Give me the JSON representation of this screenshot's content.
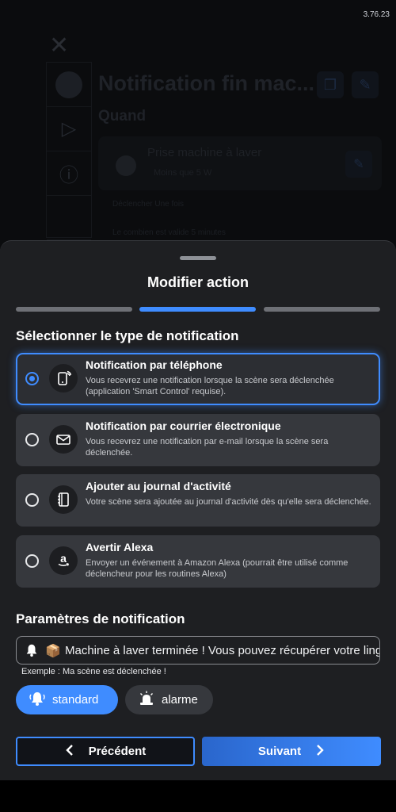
{
  "status_bar": {
    "version": "3.76.23"
  },
  "background": {
    "title": "Notification fin mac...",
    "section": "Quand",
    "trigger": {
      "title": "Prise machine à laver",
      "condition": "Moins que 5 W",
      "cond1": "Déclencher Une fois",
      "cond2": "Le combien est valide 5 minutes"
    }
  },
  "sheet": {
    "title": "Modifier action",
    "steps": [
      {
        "state": "done"
      },
      {
        "state": "active"
      },
      {
        "state": "todo"
      }
    ],
    "type_section_title": "Sélectionner le type de notification",
    "options": [
      {
        "title": "Notification par téléphone",
        "description": "Vous recevrez une notification lorsque la scène sera déclenchée (application 'Smart Control' requise).",
        "icon": "phone-notification-icon",
        "selected": true
      },
      {
        "title": "Notification par courrier électronique",
        "description": "Vous recevrez une notification par e-mail lorsque la scène sera déclenchée.",
        "icon": "envelope-icon",
        "selected": false
      },
      {
        "title": "Ajouter au journal d'activité",
        "description": "Votre scène sera ajoutée au journal d'activité dès qu'elle sera déclenchée.",
        "icon": "journal-icon",
        "selected": false
      },
      {
        "title": "Avertir Alexa",
        "description": "Envoyer un événement à Amazon Alexa (pourrait être utilisé comme déclencheur pour les routines Alexa)",
        "icon": "amazon-icon",
        "selected": false
      }
    ],
    "params_section_title": "Paramètres de notification",
    "message": {
      "emoji": "📦",
      "value": "Machine à laver terminée ! Vous pouvez récupérer votre linge"
    },
    "example": "Exemple : Ma scène est déclenchée !",
    "sound_options": [
      {
        "label": "standard",
        "icon": "bell-icon",
        "selected": true
      },
      {
        "label": "alarme",
        "icon": "siren-icon",
        "selected": false
      }
    ],
    "buttons": {
      "previous": "Précédent",
      "next": "Suivant"
    }
  },
  "colors": {
    "accent": "#3f8cff",
    "sheet_bg": "#1e1f22",
    "card_bg": "#36383d"
  }
}
